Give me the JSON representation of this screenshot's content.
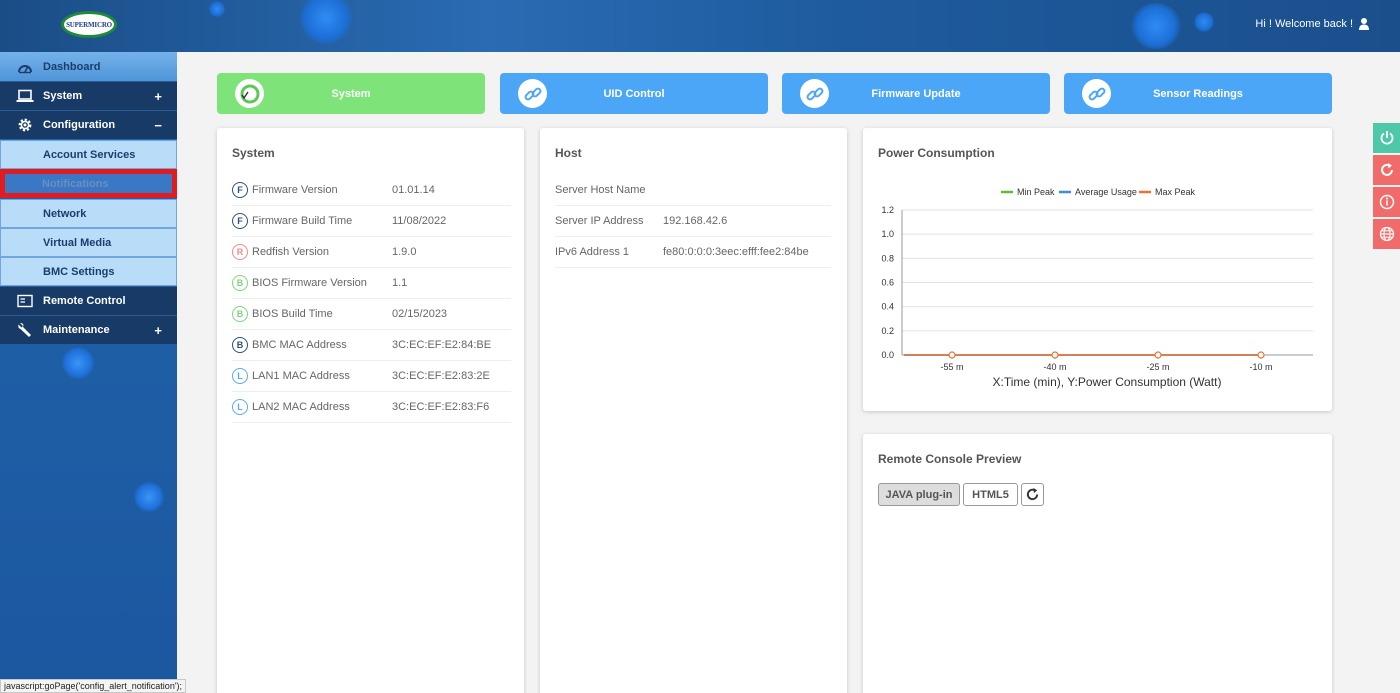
{
  "header": {
    "logo_text": "SUPERMICRO",
    "welcome": "Hi ! Welcome back !"
  },
  "sidebar": {
    "dashboard": "Dashboard",
    "system": "System",
    "configuration": "Configuration",
    "config_items": [
      "Account Services",
      "Notifications",
      "Network",
      "Virtual Media",
      "BMC Settings"
    ],
    "remote_control": "Remote Control",
    "maintenance": "Maintenance",
    "plus": "+",
    "minus": "−"
  },
  "status_url": "javascript:goPage('config_alert_notification');",
  "top_cards": [
    {
      "label": "System",
      "color": "#7ee47a"
    },
    {
      "label": "UID Control",
      "color": "#4ca6f7"
    },
    {
      "label": "Firmware Update",
      "color": "#4ca6f7"
    },
    {
      "label": "Sensor Readings",
      "color": "#4ca6f7"
    }
  ],
  "system_panel": {
    "title": "System",
    "rows": [
      {
        "badge": "F",
        "badge_color": "#2d4f7a",
        "key": "Firmware Version",
        "value": "01.01.14"
      },
      {
        "badge": "F",
        "badge_color": "#2d4f7a",
        "key": "Firmware Build Time",
        "value": "11/08/2022"
      },
      {
        "badge": "R",
        "badge_color": "#f08a8a",
        "key": "Redfish Version",
        "value": "1.9.0"
      },
      {
        "badge": "B",
        "badge_color": "#7fd67a",
        "key": "BIOS Firmware Version",
        "value": "1.1"
      },
      {
        "badge": "B",
        "badge_color": "#7fd67a",
        "key": "BIOS Build Time",
        "value": "02/15/2023"
      },
      {
        "badge": "B",
        "badge_color": "#2d4f7a",
        "key": "BMC MAC Address",
        "value": "3C:EC:EF:E2:84:BE"
      },
      {
        "badge": "L",
        "badge_color": "#5aaaf0",
        "key": "LAN1 MAC Address",
        "value": "3C:EC:EF:E2:83:2E"
      },
      {
        "badge": "L",
        "badge_color": "#5aaaf0",
        "key": "LAN2 MAC Address",
        "value": "3C:EC:EF:E2:83:F6"
      }
    ]
  },
  "host_panel": {
    "title": "Host",
    "rows": [
      {
        "key": "Server Host Name",
        "value": ""
      },
      {
        "key": "Server IP Address",
        "value": "192.168.42.6"
      },
      {
        "key": "IPv6 Address 1",
        "value": "fe80:0:0:0:3eec:efff:fee2:84be"
      }
    ]
  },
  "power_panel": {
    "title": "Power Consumption"
  },
  "chart_data": {
    "type": "line",
    "x": [
      "-55 m",
      "-40 m",
      "-25 m",
      "-10 m"
    ],
    "series": [
      {
        "name": "Min Peak",
        "color": "#66bb2e",
        "values": [
          0,
          0,
          0,
          0
        ]
      },
      {
        "name": "Average Usage",
        "color": "#3a8df0",
        "values": [
          0,
          0,
          0,
          0
        ]
      },
      {
        "name": "Max Peak",
        "color": "#f07030",
        "values": [
          0,
          0,
          0,
          0
        ]
      }
    ],
    "yticks": [
      "1.2",
      "1.0",
      "0.8",
      "0.6",
      "0.4",
      "0.2",
      "0.0"
    ],
    "ylim": [
      0,
      1.2
    ],
    "xlabel": "X:Time (min), Y:Power Consumption (Watt)",
    "legend": "top-center",
    "grid": true
  },
  "console_panel": {
    "title": "Remote Console Preview",
    "java_btn": "JAVA plug-in",
    "html5_btn": "HTML5"
  }
}
